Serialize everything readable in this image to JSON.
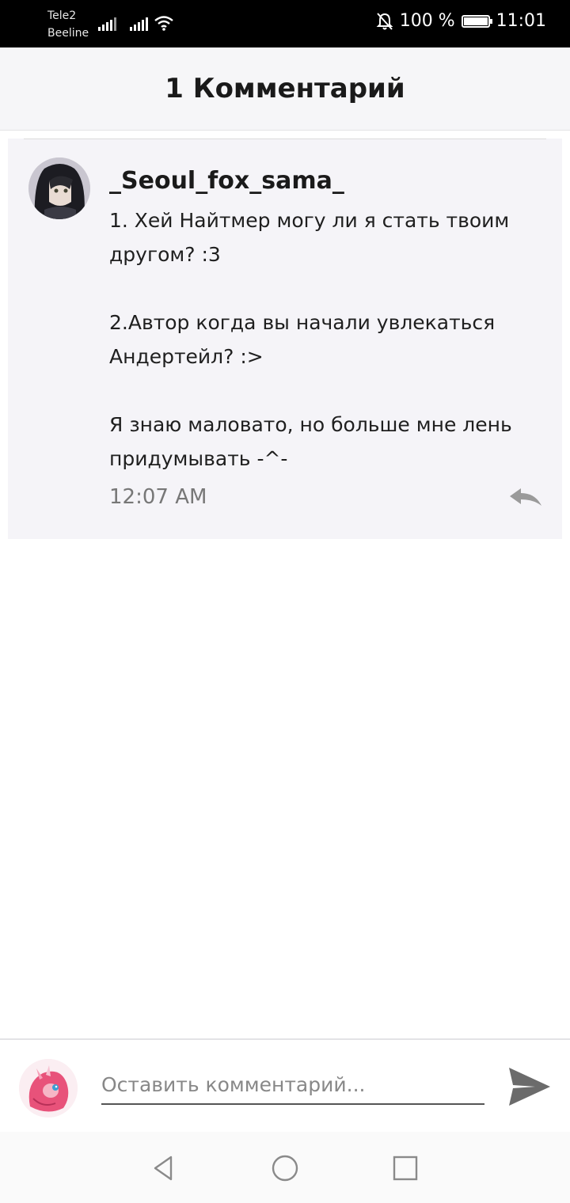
{
  "status_bar": {
    "carrier_1": "Tele2",
    "carrier_2": "Beeline",
    "battery": "100 %",
    "time": "11:01"
  },
  "header": {
    "title": "1 Комментарий"
  },
  "comment": {
    "username": "_Seoul_fox_sama_",
    "text": "1. Хей Найтмер могу ли я стать твоим другом? :3\n\n2.Автор когда вы начали увлекаться Андертейл? :>\n\nЯ знаю маловато, но больше мне лень придумывать -^-",
    "timestamp": "12:07 AM"
  },
  "composer": {
    "placeholder": "Оставить комментарий..."
  },
  "icons": {
    "mute": "bell-off-icon",
    "reply": "reply-icon",
    "send": "send-icon",
    "back": "nav-back-icon",
    "home": "nav-home-icon",
    "recents": "nav-recents-icon"
  },
  "colors": {
    "header_bg": "#f6f6f8",
    "card_bg": "#f5f4f8",
    "status_bar": "#000000",
    "send": "#6b6b6b"
  }
}
